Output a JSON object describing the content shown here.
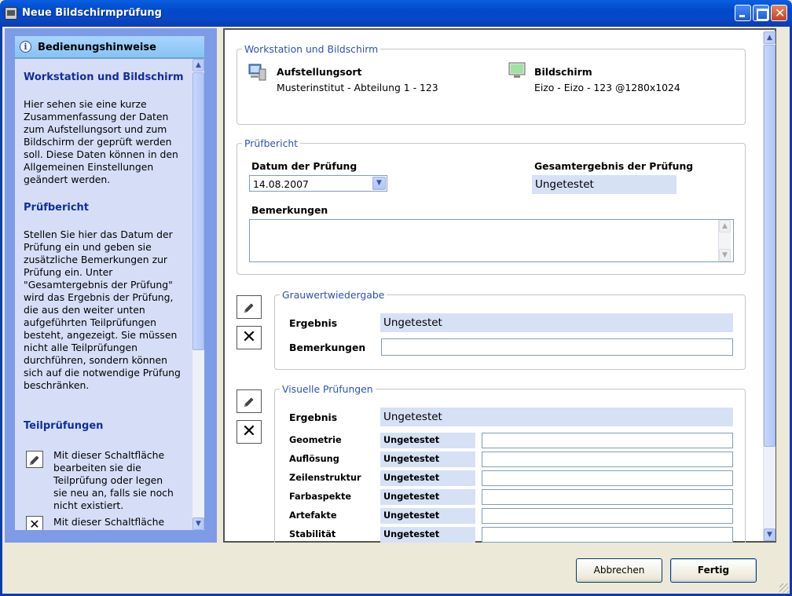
{
  "window": {
    "title": "Neue Bildschirmprüfung"
  },
  "help": {
    "header": "Bedienungshinweise",
    "sections": [
      {
        "title": "Workstation und Bildschirm",
        "text": "Hier sehen sie eine kurze Zusammenfassung der Daten zum Aufstellungsort und zum Bildschirm der geprüft werden soll. Diese Daten können in den Allgemeinen Einstellungen geändert werden."
      },
      {
        "title": "Prüfbericht",
        "text": "Stellen Sie hier das Datum der Prüfung ein und geben sie zusätzliche Bemerkungen zur Prüfung ein. Unter \"Gesamtergebnis der Prüfung\" wird das Ergebnis der Prüfung, die aus den weiter unten aufgeführten Teilprüfungen besteht, angezeigt. Sie müssen nicht alle Teilprüfungen durchführen, sondern können sich auf die notwendige Prüfung beschränken."
      },
      {
        "title": "Teilprüfungen",
        "text": ""
      }
    ],
    "items": [
      {
        "text": "Mit dieser Schaltfläche bearbeiten sie die Teilprüfung oder legen sie neu an, falls sie noch nicht existiert."
      },
      {
        "text": "Mit dieser Schaltfläche"
      }
    ]
  },
  "workstation": {
    "legend": "Workstation und Bildschirm",
    "location_label": "Aufstellungsort",
    "location_value": "Musterinstitut - Abteilung 1 - 123",
    "screen_label": "Bildschirm",
    "screen_value": "Eizo - Eizo - 123 @1280x1024"
  },
  "report": {
    "legend": "Prüfbericht",
    "date_label": "Datum der Prüfung",
    "date_value": "14.08.2007",
    "overall_label": "Gesamtergebnis der Prüfung",
    "overall_value": "Ungetestet",
    "remarks_label": "Bemerkungen",
    "remarks_value": ""
  },
  "grayscale": {
    "legend": "Grauwertwiedergabe",
    "result_label": "Ergebnis",
    "result_value": "Ungetestet",
    "remarks_label": "Bemerkungen",
    "remarks_value": ""
  },
  "visual": {
    "legend": "Visuelle Prüfungen",
    "result_label": "Ergebnis",
    "result_value": "Ungetestet",
    "rows": [
      {
        "label": "Geometrie",
        "value": "Ungetestet"
      },
      {
        "label": "Auflösung",
        "value": "Ungetestet"
      },
      {
        "label": "Zeilenstruktur",
        "value": "Ungetestet"
      },
      {
        "label": "Farbaspekte",
        "value": "Ungetestet"
      },
      {
        "label": "Artefakte",
        "value": "Ungetestet"
      },
      {
        "label": "Stabilität",
        "value": "Ungetestet"
      }
    ]
  },
  "buttons": {
    "cancel": "Abbrechen",
    "finish": "Fertig"
  },
  "icons": {
    "app": "monitor-app-icon",
    "info": "info-icon",
    "edit": "pencil-icon",
    "delete": "x-icon",
    "workstation": "computer-icon",
    "screen": "monitor-icon"
  }
}
